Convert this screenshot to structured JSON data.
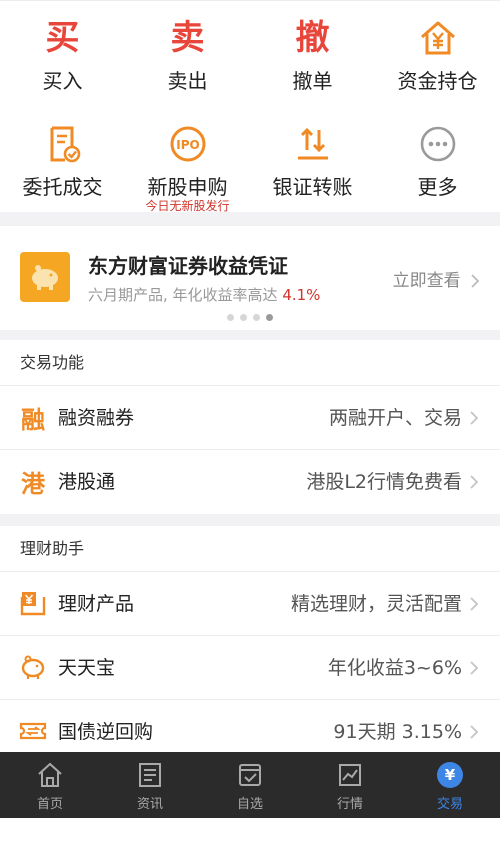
{
  "colors": {
    "accent_red": "#e8463b",
    "accent_orange": "#f08a24",
    "active_tab": "#3e86e6",
    "tabbar_bg": "#2b2b2b"
  },
  "quick_actions": [
    {
      "label": "买入",
      "glyph": "买",
      "icon": "buy-icon"
    },
    {
      "label": "卖出",
      "glyph": "卖",
      "icon": "sell-icon"
    },
    {
      "label": "撤单",
      "glyph": "撤",
      "icon": "cancel-order-icon"
    },
    {
      "label": "资金持仓",
      "icon": "house-yen-icon"
    },
    {
      "label": "委托成交",
      "icon": "document-check-icon"
    },
    {
      "label": "新股申购",
      "icon": "ipo-icon",
      "sub": "今日无新股发行"
    },
    {
      "label": "银证转账",
      "icon": "transfer-arrows-icon"
    },
    {
      "label": "更多",
      "icon": "more-dots-icon"
    }
  ],
  "ipo_badge_text": "IPO",
  "banner": {
    "title": "东方财富证券收益凭证",
    "subtitle_prefix": "六月期产品, 年化收益率高达 ",
    "rate": "4.1%",
    "link": "立即查看",
    "pages": 4,
    "active_page": 4
  },
  "trading": {
    "heading": "交易功能",
    "items": [
      {
        "icon_char": "融",
        "icon": "margin-icon",
        "title": "融资融券",
        "value": "两融开户、交易"
      },
      {
        "icon_char": "港",
        "icon": "hk-stock-icon",
        "title": "港股通",
        "value": "港股L2行情免费看"
      }
    ]
  },
  "wealth": {
    "heading": "理财助手",
    "items": [
      {
        "icon": "wealth-product-icon",
        "title": "理财产品",
        "value": "精选理财，灵活配置"
      },
      {
        "icon": "piggy-bank-icon",
        "title": "天天宝",
        "value": "年化收益3~6%"
      },
      {
        "icon": "ticket-icon",
        "title": "国债逆回购",
        "value": "91天期 3.15%"
      }
    ]
  },
  "tabs": [
    {
      "label": "首页",
      "icon": "home-icon",
      "active": false
    },
    {
      "label": "资讯",
      "icon": "news-icon",
      "active": false
    },
    {
      "label": "自选",
      "icon": "watchlist-icon",
      "active": false
    },
    {
      "label": "行情",
      "icon": "market-chart-icon",
      "active": false
    },
    {
      "label": "交易",
      "icon": "trade-yen-icon",
      "active": true
    }
  ],
  "trade_tab_glyph": "¥"
}
